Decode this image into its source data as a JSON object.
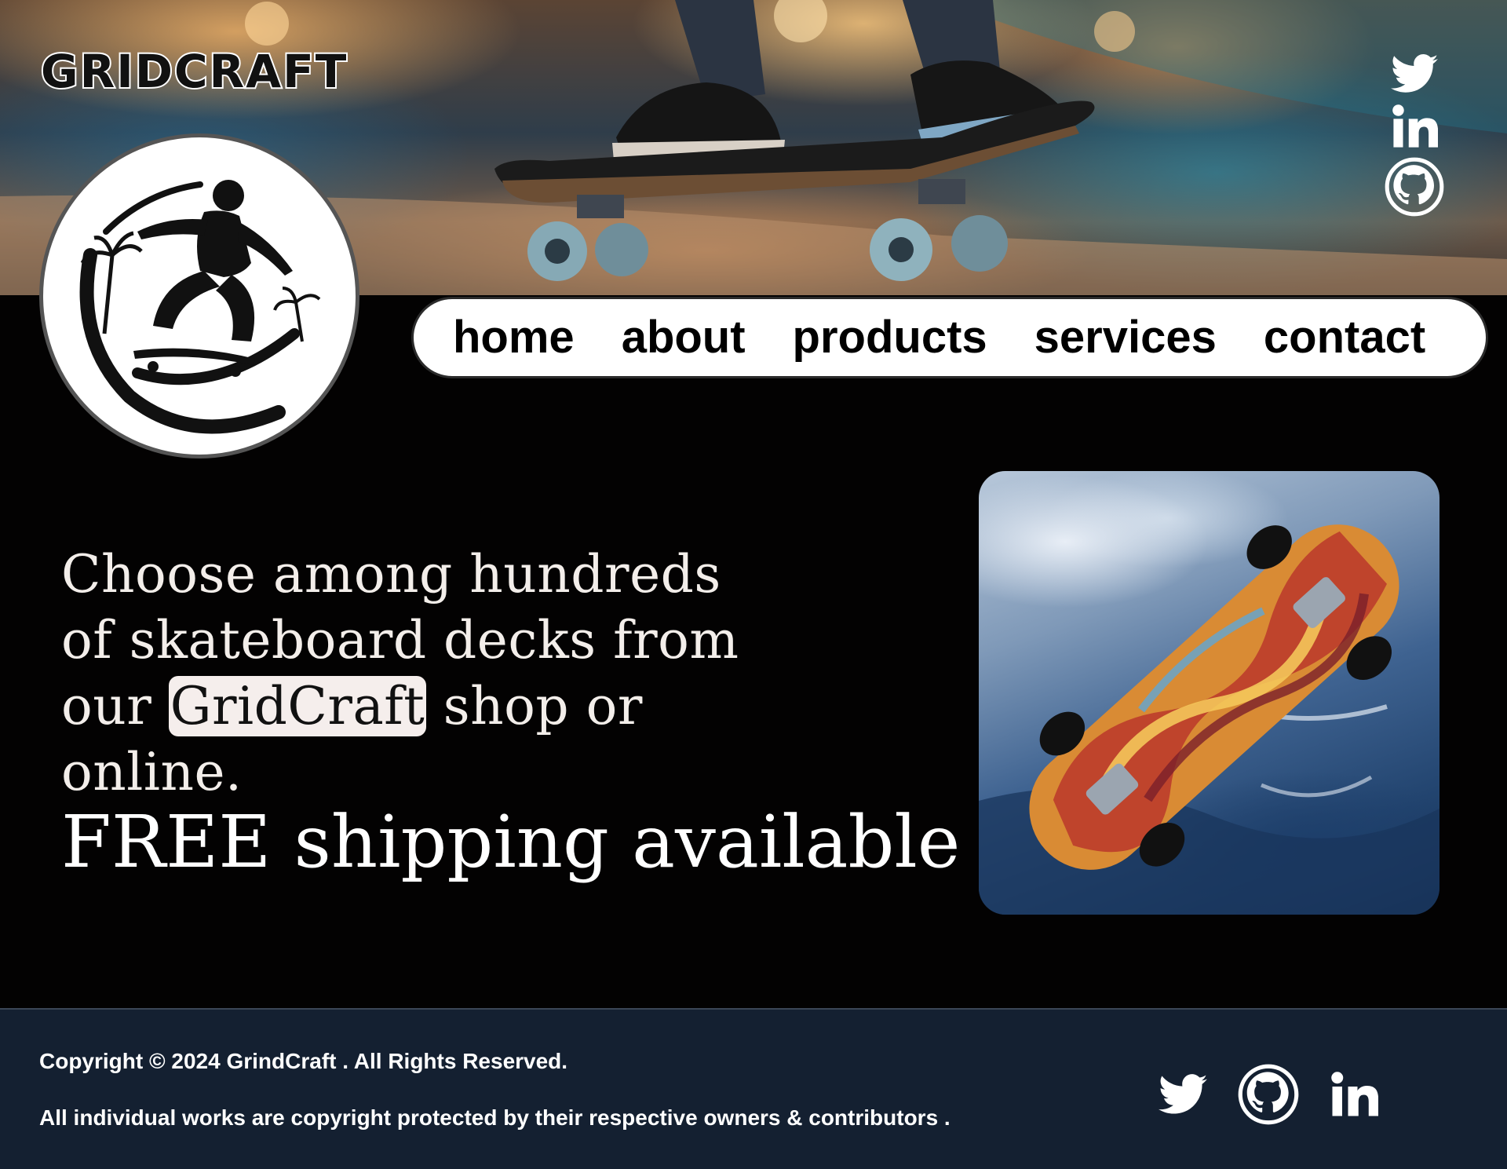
{
  "header": {
    "brand": "GRIDCRAFT",
    "social_icons": [
      "twitter-icon",
      "linkedin-icon",
      "github-icon"
    ]
  },
  "nav": {
    "items": [
      {
        "label": "home"
      },
      {
        "label": "about"
      },
      {
        "label": "products"
      },
      {
        "label": "services"
      },
      {
        "label": "contact"
      }
    ]
  },
  "main": {
    "intro_before": "Choose among hundreds of skateboard decks from our ",
    "intro_highlight": "GridCraft",
    "intro_after": " shop or online.",
    "promo": "FREE shipping available"
  },
  "footer": {
    "copyright": "Copyright © 2024 GrindCraft . All Rights Reserved.",
    "notice": "All individual works are copyright protected by their respective owners & contributors .",
    "social_icons": [
      "twitter-icon",
      "github-icon",
      "linkedin-icon"
    ]
  },
  "colors": {
    "background": "#030202",
    "nav_bg": "#ffffff",
    "footer_bg": "#142031",
    "text_light": "#f3eeea",
    "highlight_bg": "#f5eeec"
  }
}
